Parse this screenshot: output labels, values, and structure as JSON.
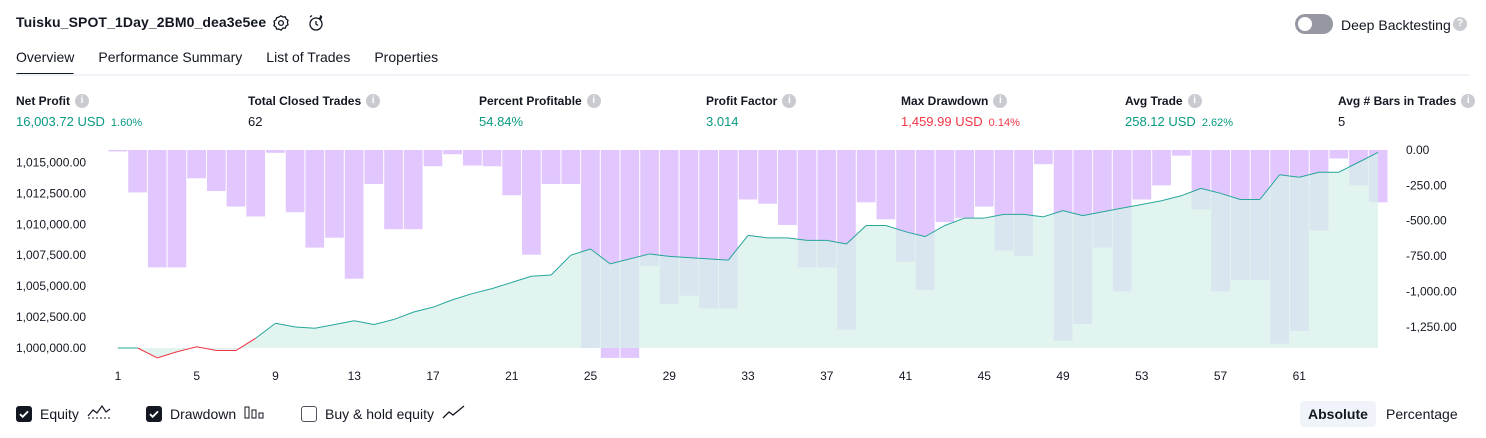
{
  "header": {
    "strategy_title": "Tuisku_SPOT_1Day_2BM0_dea3e5ee",
    "deep_backtesting_label": "Deep Backtesting",
    "deep_backtesting_enabled": false
  },
  "tabs": [
    {
      "label": "Overview",
      "active": true
    },
    {
      "label": "Performance Summary",
      "active": false
    },
    {
      "label": "List of Trades",
      "active": false
    },
    {
      "label": "Properties",
      "active": false
    }
  ],
  "metrics": {
    "net_profit": {
      "label": "Net Profit",
      "value": "16,003.72 USD",
      "pct": "1.60%"
    },
    "total_closed_trades": {
      "label": "Total Closed Trades",
      "value": "62"
    },
    "percent_profitable": {
      "label": "Percent Profitable",
      "value": "54.84%"
    },
    "profit_factor": {
      "label": "Profit Factor",
      "value": "3.014"
    },
    "max_drawdown": {
      "label": "Max Drawdown",
      "value": "1,459.99 USD",
      "pct": "0.14%"
    },
    "avg_trade": {
      "label": "Avg Trade",
      "value": "258.12 USD",
      "pct": "2.62%"
    },
    "avg_bars": {
      "label": "Avg # Bars in Trades",
      "value": "5"
    }
  },
  "legend": {
    "equity_label": "Equity",
    "equity_checked": true,
    "drawdown_label": "Drawdown",
    "drawdown_checked": true,
    "buyhold_label": "Buy & hold equity",
    "buyhold_checked": false
  },
  "view_toggle": {
    "absolute_label": "Absolute",
    "percentage_label": "Percentage",
    "selected": "Absolute"
  },
  "colors": {
    "equity_line": "#26a69a",
    "equity_fill": "#d7f0ea",
    "equity_negative": "#f23645",
    "drawdown_bar": "#e1c7fd",
    "positive_text": "#089981",
    "negative_text": "#f23645"
  },
  "chart_data": {
    "type": "area",
    "x": [
      1,
      2,
      3,
      4,
      5,
      6,
      7,
      8,
      9,
      10,
      11,
      12,
      13,
      14,
      15,
      16,
      17,
      18,
      19,
      20,
      21,
      22,
      23,
      24,
      25,
      26,
      27,
      28,
      29,
      30,
      31,
      32,
      33,
      34,
      35,
      36,
      37,
      38,
      39,
      40,
      41,
      42,
      43,
      44,
      45,
      46,
      47,
      48,
      49,
      50,
      51,
      52,
      53,
      54,
      55,
      56,
      57,
      58,
      59,
      60,
      61,
      62,
      63
    ],
    "x_ticks": [
      "1",
      "5",
      "9",
      "13",
      "17",
      "21",
      "25",
      "29",
      "33",
      "37",
      "41",
      "45",
      "49",
      "53",
      "57",
      "61"
    ],
    "y_left_ticks": [
      "1,000,000.00",
      "1,002,500.00",
      "1,005,000.00",
      "1,007,500.00",
      "1,010,000.00",
      "1,012,500.00",
      "1,015,000.00"
    ],
    "y_left_range": [
      999000,
      1016000
    ],
    "y_right_ticks": [
      "0.00",
      "-250.00",
      "-500.00",
      "-750.00",
      "-1,000.00",
      "-1,250.00"
    ],
    "y_right_range": [
      -1400,
      0
    ],
    "series": [
      {
        "name": "Equity",
        "values": [
          1000000,
          1000000,
          999200,
          999700,
          1000100,
          999800,
          999800,
          1000800,
          1002000,
          1001700,
          1001600,
          1001900,
          1002200,
          1001900,
          1002300,
          1002900,
          1003300,
          1003900,
          1004400,
          1004800,
          1005300,
          1005800,
          1005900,
          1007500,
          1008000,
          1006800,
          1007200,
          1007600,
          1007400,
          1007300,
          1007200,
          1007100,
          1009100,
          1008900,
          1008900,
          1008700,
          1008700,
          1008400,
          1009900,
          1009900,
          1009400,
          1009000,
          1009900,
          1010500,
          1010500,
          1010800,
          1010800,
          1010600,
          1011100,
          1010700,
          1011000,
          1011300,
          1011600,
          1011900,
          1012300,
          1012900,
          1012500,
          1012000,
          1012000,
          1014000,
          1013800,
          1014200,
          1014200,
          1015000,
          1015800
        ],
        "_note_": ""
      },
      {
        "name": "Drawdown",
        "values": [
          -10,
          -300,
          -830,
          -830,
          -200,
          -290,
          -400,
          -470,
          -20,
          -440,
          -690,
          -620,
          -910,
          -240,
          -560,
          -560,
          -115,
          -30,
          -110,
          -115,
          -320,
          -740,
          -240,
          -240,
          -1400,
          -1470,
          -1470,
          -820,
          -1090,
          -1030,
          -1120,
          -1120,
          -350,
          -380,
          -530,
          -830,
          -830,
          -1270,
          -370,
          -490,
          -790,
          -990,
          -510,
          -480,
          -400,
          -710,
          -750,
          -100,
          -1350,
          -1230,
          -690,
          -1000,
          -350,
          -250,
          -40,
          -420,
          -1000,
          -920,
          -920,
          -1370,
          -1280,
          -570,
          -60,
          -250,
          -370
        ]
      }
    ]
  }
}
